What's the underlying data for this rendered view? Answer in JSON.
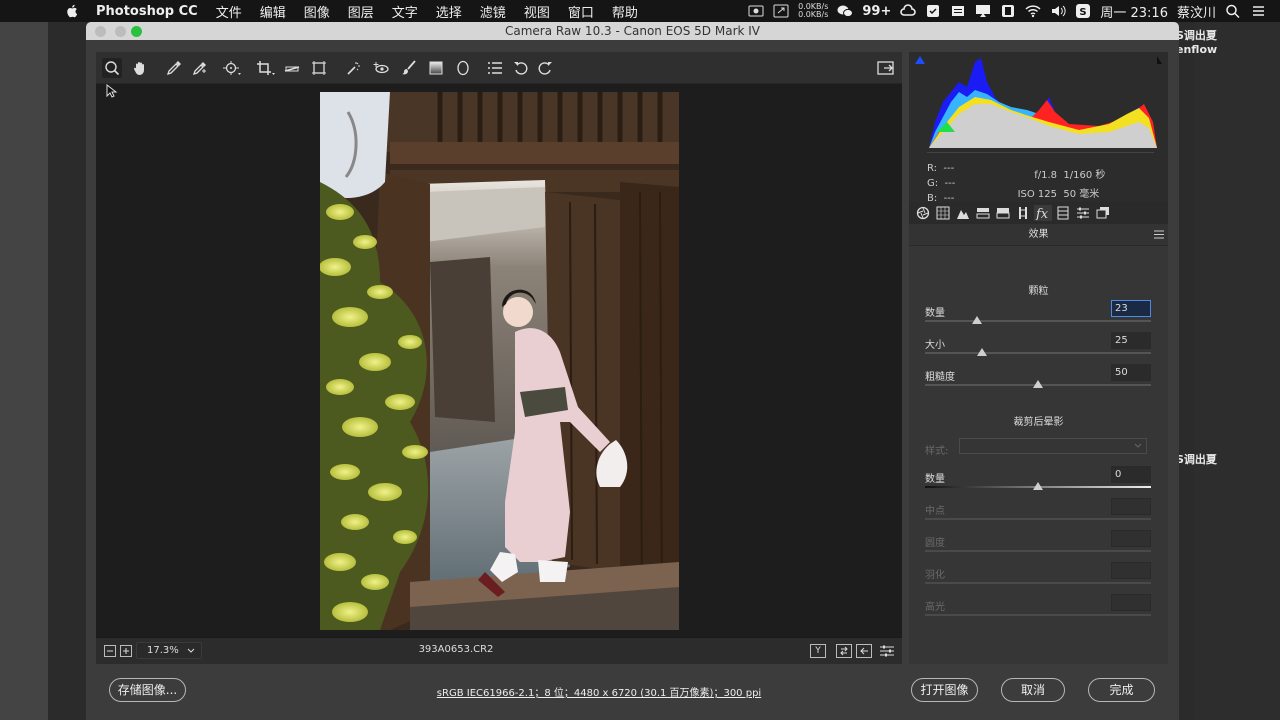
{
  "menubar": {
    "app": "Photoshop CC",
    "items": [
      "文件",
      "编辑",
      "图像",
      "图层",
      "文字",
      "选择",
      "滤镜",
      "视图",
      "窗口",
      "帮助"
    ],
    "net_up": "0.0KB/s",
    "net_down": "0.0KB/s",
    "badge": "99+",
    "clock": "周一 23:16",
    "user": "蔡汶川"
  },
  "desktop": {
    "right_labels": [
      "S调出夏",
      "enflow",
      "S调出夏"
    ]
  },
  "window": {
    "title": "Camera Raw 10.3  -  Canon EOS 5D Mark IV"
  },
  "status": {
    "zoom": "17.3%",
    "filename": "393A0653.CR2",
    "y_label": "Y"
  },
  "info": {
    "r": "R:",
    "g": "G:",
    "b": "B:",
    "r_val": "---",
    "g_val": "---",
    "b_val": "---",
    "aperture": "f/1.8",
    "shutter": "1/160 秒",
    "iso": "ISO 125",
    "focal": "50 毫米"
  },
  "panel": {
    "title": "效果",
    "grain": {
      "heading": "颗粒",
      "sliders": [
        {
          "label": "数量",
          "value": "23",
          "pos": 0.23
        },
        {
          "label": "大小",
          "value": "25",
          "pos": 0.25
        },
        {
          "label": "粗糙度",
          "value": "50",
          "pos": 0.5
        }
      ]
    },
    "vignette": {
      "heading": "裁剪后晕影",
      "style_label": "样式:",
      "amount_label": "数量",
      "amount_value": "0",
      "amount_pos": 0.5,
      "disabled": [
        "中点",
        "圆度",
        "羽化",
        "高光"
      ]
    }
  },
  "footer": {
    "save": "存储图像...",
    "link": "sRGB IEC61966-2.1；8 位；4480 x 6720 (30.1 百万像素)；300 ppi",
    "open": "打开图像",
    "cancel": "取消",
    "done": "完成"
  }
}
